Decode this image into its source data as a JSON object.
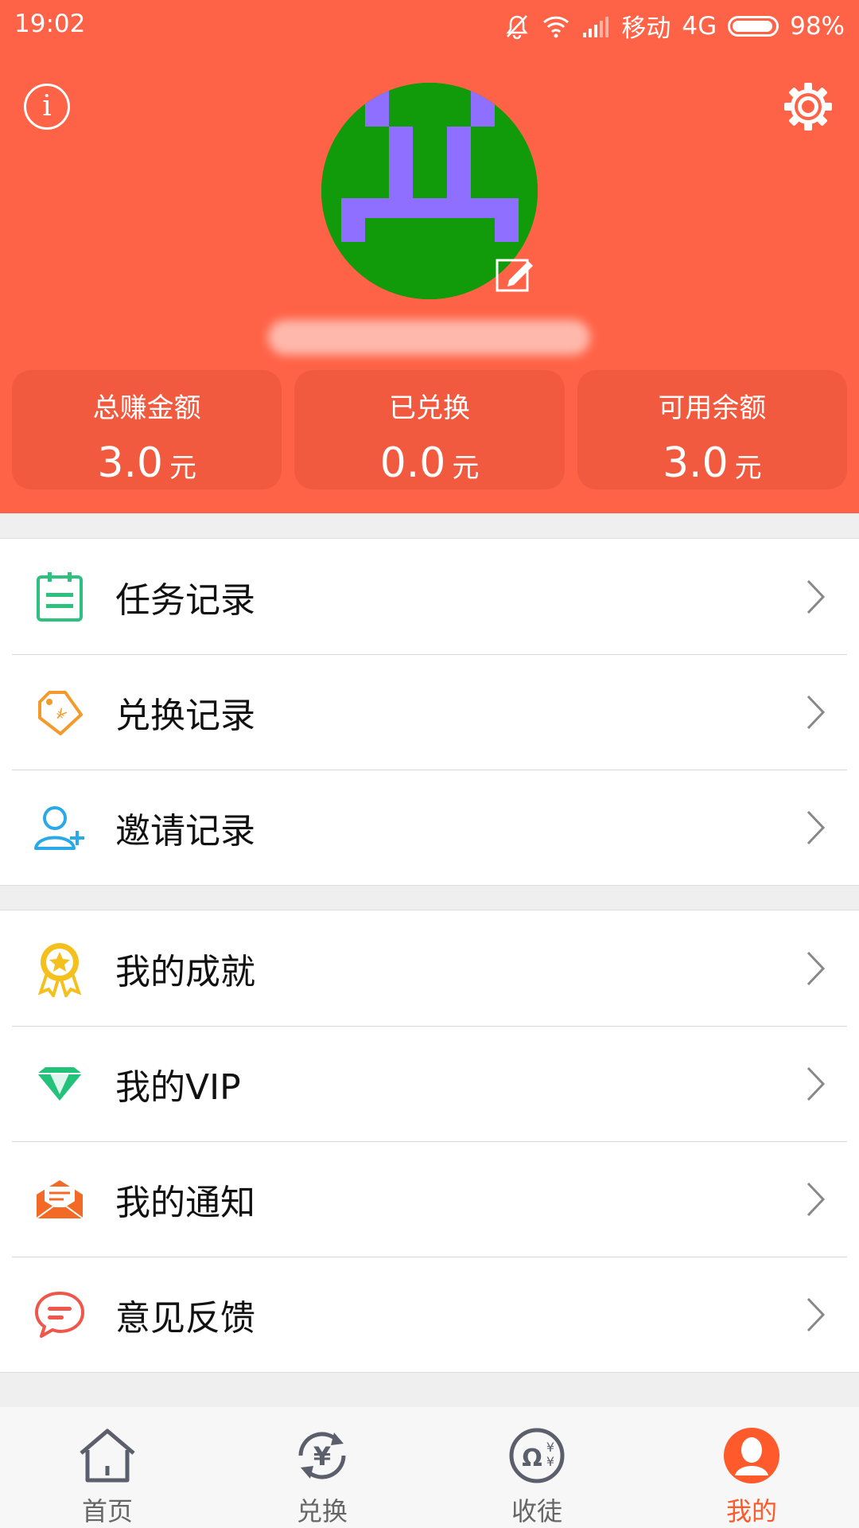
{
  "status_bar": {
    "time": "19:02",
    "carrier": "移动",
    "network": "4G",
    "battery": "98%"
  },
  "profile": {
    "nickname": ""
  },
  "stats": [
    {
      "label": "总赚金额",
      "value": "3.0",
      "unit": "元"
    },
    {
      "label": "已兑换",
      "value": "0.0",
      "unit": "元"
    },
    {
      "label": "可用余额",
      "value": "3.0",
      "unit": "元"
    }
  ],
  "menu_group_1": [
    {
      "label": "任务记录",
      "icon": "clipboard-icon"
    },
    {
      "label": "兑换记录",
      "icon": "tag-icon"
    },
    {
      "label": "邀请记录",
      "icon": "add-user-icon"
    }
  ],
  "menu_group_2": [
    {
      "label": "我的成就",
      "icon": "medal-icon"
    },
    {
      "label": "我的VIP",
      "icon": "diamond-icon"
    },
    {
      "label": "我的通知",
      "icon": "envelope-icon"
    },
    {
      "label": "意见反馈",
      "icon": "chat-bubble-icon"
    }
  ],
  "tabs": [
    {
      "label": "首页",
      "icon": "home-icon"
    },
    {
      "label": "兑换",
      "icon": "exchange-icon"
    },
    {
      "label": "收徒",
      "icon": "apprentice-icon"
    },
    {
      "label": "我的",
      "icon": "profile-icon",
      "active": true
    }
  ],
  "colors": {
    "header": "#ff6347",
    "stat_card": "#f25a3f",
    "active_tab": "#ff5a2c"
  }
}
